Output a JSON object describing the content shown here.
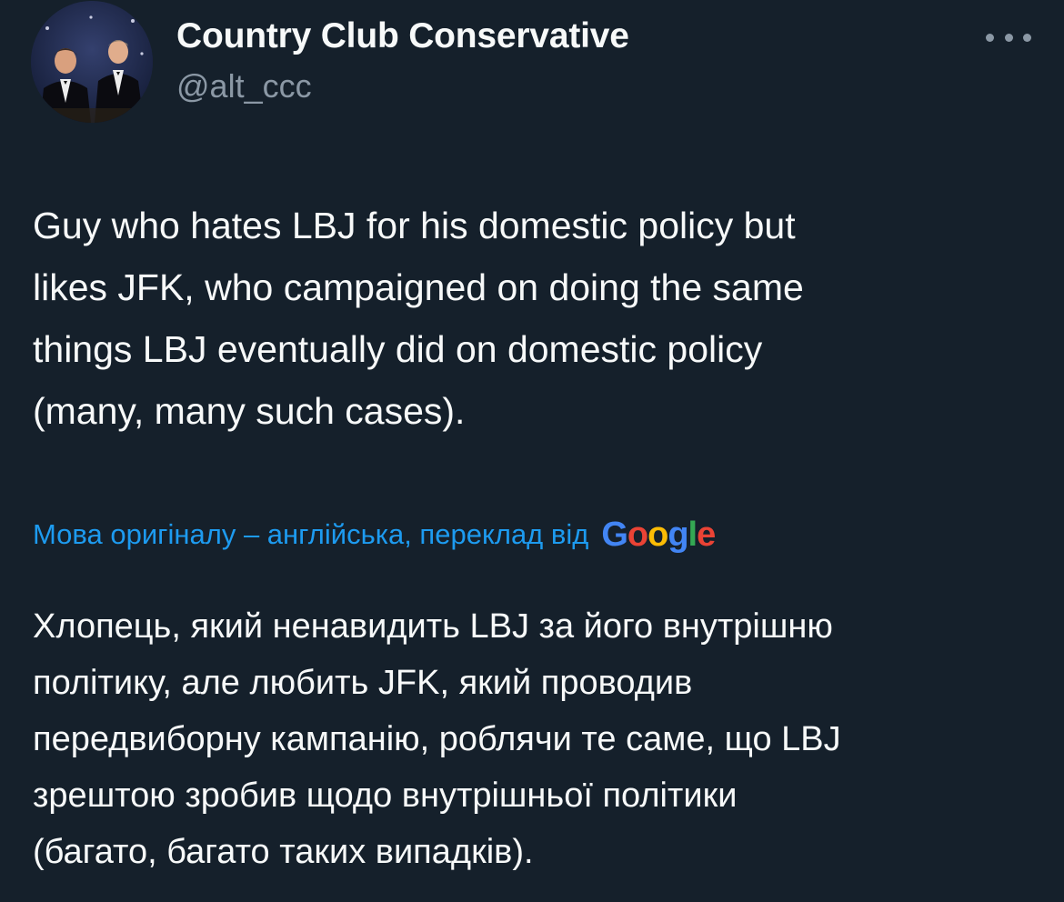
{
  "author": {
    "display_name": "Country Club Conservative",
    "handle": "@alt_ccc",
    "avatar_icon": "profile-photo"
  },
  "more_icon": "more-horizontal-icon",
  "tweet": {
    "lines": [
      "Guy who hates LBJ for his domestic policy but",
      "likes JFK, who campaigned on doing the same",
      "things LBJ eventually did on domestic policy",
      "(many, many such cases)."
    ]
  },
  "translation": {
    "label": "Мова оригіналу – англійська, переклад від",
    "provider": {
      "letters": [
        "G",
        "o",
        "o",
        "g",
        "l",
        "e"
      ],
      "colors": [
        "#4285f4",
        "#ea4335",
        "#fbbc05",
        "#4285f4",
        "#34a853",
        "#ea4335"
      ]
    },
    "lines": [
      "Хлопець, який ненавидить LBJ за його внутрішню",
      "політику, але любить JFK, який проводив",
      "передвиборну кампанію, роблячи те саме, що LBJ",
      "зрештою зробив щодо внутрішньої політики",
      "(багато, багато таких випадків)."
    ]
  },
  "colors": {
    "background": "#15202b",
    "text_primary": "#f7f9f9",
    "text_secondary": "#8b98a5",
    "link": "#1d9bf0"
  }
}
